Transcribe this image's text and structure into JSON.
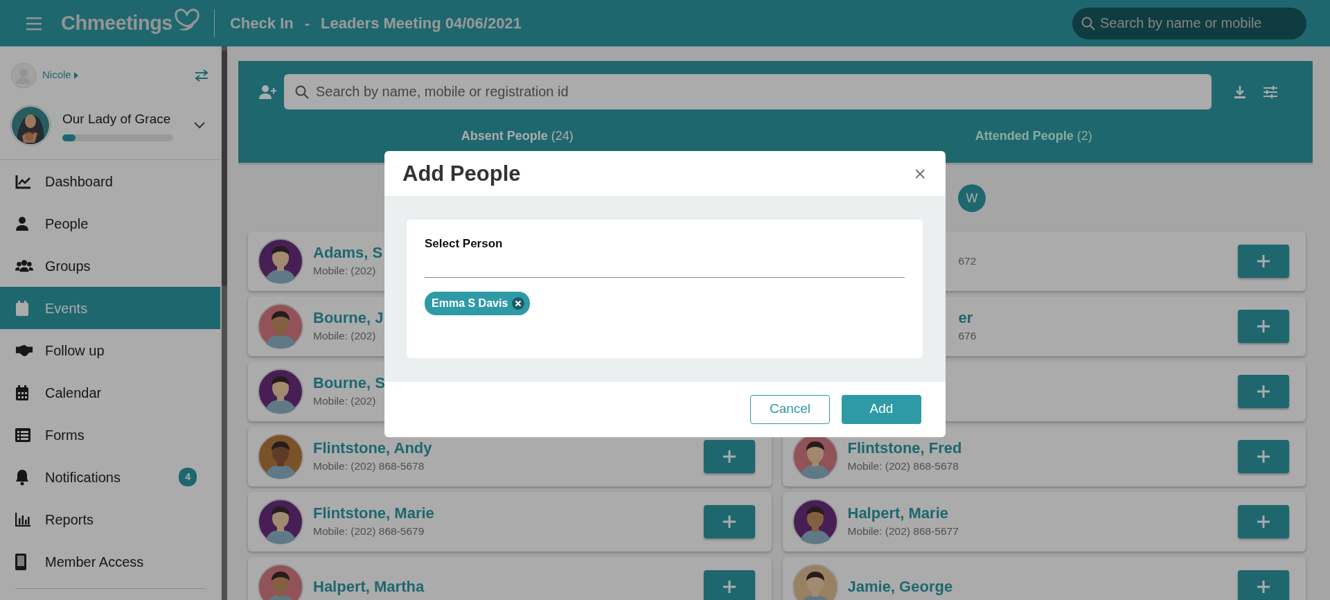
{
  "header": {
    "logo": "Chmeetings",
    "title": "Check In",
    "separator": "-",
    "subtitle": "Leaders Meeting 04/06/2021",
    "search": {
      "placeholder": "Search by name or mobile"
    }
  },
  "sidebar": {
    "user": "Nicole",
    "organization": {
      "name": "Our Lady of Grace",
      "level": 0.12
    },
    "items": [
      {
        "label": "Dashboard",
        "kind": "chart",
        "selected": false
      },
      {
        "label": "People",
        "kind": "person",
        "selected": false
      },
      {
        "label": "Groups",
        "kind": "group",
        "selected": false
      },
      {
        "label": "Events",
        "kind": "calendar",
        "selected": true
      },
      {
        "label": "Follow up",
        "kind": "handshake",
        "selected": false
      },
      {
        "label": "Calendar",
        "kind": "calendar-grid",
        "selected": false
      },
      {
        "label": "Forms",
        "kind": "list",
        "selected": false
      },
      {
        "label": "Notifications",
        "kind": "bell",
        "selected": false,
        "badge": "4"
      },
      {
        "label": "Reports",
        "kind": "bars",
        "selected": false
      },
      {
        "label": "Member Access",
        "kind": "phone",
        "selected": false
      }
    ]
  },
  "main": {
    "search": {
      "placeholder": "Search by name, mobile or registration id"
    },
    "tabs": [
      {
        "label": "Absent People",
        "count": "(24)",
        "selected": true
      },
      {
        "label": "Attended People",
        "count": "(2)",
        "selected": false
      }
    ],
    "letters": [
      {
        "label": "W"
      }
    ],
    "people": [
      {
        "name": "Adams, S",
        "mobile": "Mobile: (202)",
        "kind": "cut"
      },
      {
        "mobile": "672",
        "kind": "covered"
      },
      {
        "name": "Bourne, J",
        "mobile": "Mobile: (202)",
        "kind": "cut"
      },
      {
        "name": "er",
        "mobile": "676",
        "kind": "covered"
      },
      {
        "name": "Bourne, S",
        "mobile": "Mobile: (202)",
        "kind": "cut"
      },
      {
        "kind": "covered"
      },
      {
        "name": "Flintstone, Andy",
        "mobile": "Mobile: (202) 868-5678",
        "kind": "visible"
      },
      {
        "name": "Flintstone, Fred",
        "mobile": "Mobile: (202) 868-5678",
        "kind": "visible"
      },
      {
        "name": "Flintstone, Marie",
        "mobile": "Mobile: (202) 868-5679",
        "kind": "visible"
      },
      {
        "name": "Halpert, Marie",
        "mobile": "Mobile: (202) 868-5677",
        "kind": "visible"
      },
      {
        "name": "Halpert, Martha",
        "kind": "visible"
      },
      {
        "name": "Jamie, George",
        "kind": "visible"
      }
    ]
  },
  "modal": {
    "title": "Add People",
    "close": "×",
    "field_label": "Select Person",
    "chips": [
      {
        "label": "Emma S Davis"
      }
    ],
    "buttons": [
      {
        "label": "Cancel",
        "kind": "secondary"
      },
      {
        "label": "Add",
        "kind": "primary"
      }
    ]
  }
}
